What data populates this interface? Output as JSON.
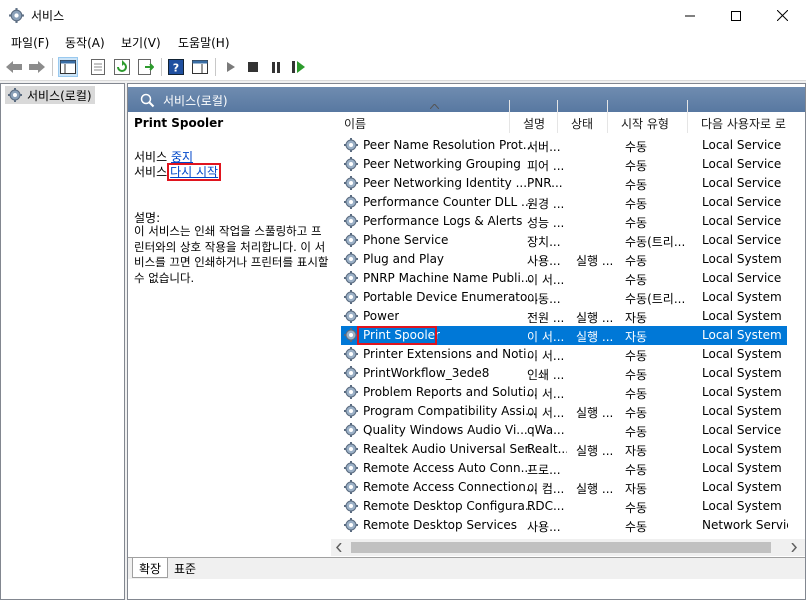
{
  "window": {
    "title": "서비스"
  },
  "menu": [
    "파일(F)",
    "동작(A)",
    "보기(V)",
    "도움말(H)"
  ],
  "tree": {
    "root_label": "서비스(로컬)"
  },
  "panel": {
    "header": "서비스(로컬)"
  },
  "details": {
    "service_name": "Print Spooler",
    "stop_prefix": "서비스",
    "stop_link": "중지",
    "restart_prefix": "서비스",
    "restart_link": "다시 시작",
    "desc_label": "설명:",
    "description": "이 서비스는 인쇄 작업을 스풀링하고 프린터와의 상호 작용을 처리합니다. 이 서비스를 끄면 인쇄하거나 프린터를 표시할 수 없습니다."
  },
  "columns": [
    "이름",
    "설명",
    "상태",
    "시작 유형",
    "다음 사용자로 로"
  ],
  "rows": [
    {
      "name": "Peer Name Resolution Prot...",
      "desc": "서버...",
      "status": "",
      "start": "수동",
      "logon": "Local Service"
    },
    {
      "name": "Peer Networking Grouping",
      "desc": "피어 ...",
      "status": "",
      "start": "수동",
      "logon": "Local Service"
    },
    {
      "name": "Peer Networking Identity ...",
      "desc": "PNR...",
      "status": "",
      "start": "수동",
      "logon": "Local Service"
    },
    {
      "name": "Performance Counter DLL ...",
      "desc": "원경 ...",
      "status": "",
      "start": "수동",
      "logon": "Local Service"
    },
    {
      "name": "Performance Logs & Alerts",
      "desc": "성능 ...",
      "status": "",
      "start": "수동",
      "logon": "Local Service"
    },
    {
      "name": "Phone Service",
      "desc": "장치...",
      "status": "",
      "start": "수동(트리...",
      "logon": "Local Service"
    },
    {
      "name": "Plug and Play",
      "desc": "사용...",
      "status": "실행 ...",
      "start": "수동",
      "logon": "Local System"
    },
    {
      "name": "PNRP Machine Name Publi...",
      "desc": "이 서...",
      "status": "",
      "start": "수동",
      "logon": "Local Service"
    },
    {
      "name": "Portable Device Enumerato...",
      "desc": "이동...",
      "status": "",
      "start": "수동(트리...",
      "logon": "Local System"
    },
    {
      "name": "Power",
      "desc": "전원 ...",
      "status": "실행 ...",
      "start": "자동",
      "logon": "Local System"
    },
    {
      "name": "Print Spooler",
      "desc": "이 서...",
      "status": "실행 ...",
      "start": "자동",
      "logon": "Local System"
    },
    {
      "name": "Printer Extensions and Noti...",
      "desc": "이 서...",
      "status": "",
      "start": "수동",
      "logon": "Local System"
    },
    {
      "name": "PrintWorkflow_3ede8",
      "desc": "인쇄 ...",
      "status": "",
      "start": "수동",
      "logon": "Local System"
    },
    {
      "name": "Problem Reports and Soluti...",
      "desc": "이 서...",
      "status": "",
      "start": "수동",
      "logon": "Local System"
    },
    {
      "name": "Program Compatibility Assi...",
      "desc": "이 서...",
      "status": "실행 ...",
      "start": "수동",
      "logon": "Local System"
    },
    {
      "name": "Quality Windows Audio Vi...",
      "desc": "qWa...",
      "status": "",
      "start": "수동",
      "logon": "Local Service"
    },
    {
      "name": "Realtek Audio Universal Ser...",
      "desc": "Realt...",
      "status": "실행 ...",
      "start": "자동",
      "logon": "Local System"
    },
    {
      "name": "Remote Access Auto Conn...",
      "desc": "프로...",
      "status": "",
      "start": "수동",
      "logon": "Local System"
    },
    {
      "name": "Remote Access Connection...",
      "desc": "이 컴...",
      "status": "실행 ...",
      "start": "자동",
      "logon": "Local System"
    },
    {
      "name": "Remote Desktop Configura...",
      "desc": "RDC...",
      "status": "",
      "start": "수동",
      "logon": "Local System"
    },
    {
      "name": "Remote Desktop Services",
      "desc": "사용...",
      "status": "",
      "start": "수동",
      "logon": "Network Service"
    }
  ],
  "tabs": [
    "확장",
    "표준"
  ],
  "colors": {
    "selection": "#0078d7",
    "highlight_box": "#e0141e",
    "link": "#0047c9",
    "header": "#5878a1"
  }
}
